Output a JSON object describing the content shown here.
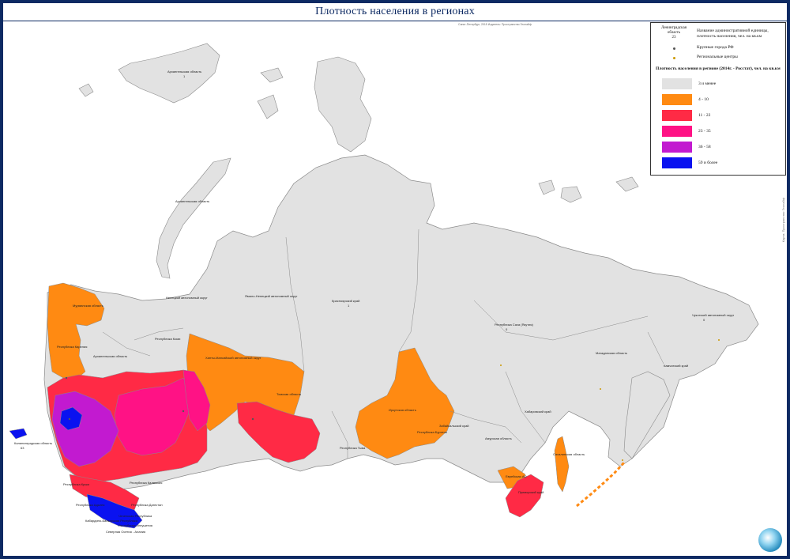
{
  "title": "Плотность населения в регионах",
  "credit": "Санкт-Петербург, 2015 Издатель: Пространство Геолайф",
  "side_credit": "Карта: Пространство Геолайф",
  "legend": {
    "sample_name": "Ленинградская область",
    "sample_value": "23",
    "sample_desc": "Название административной единицы, плотность населения, чел. на кв.км",
    "cities_label": "Крупные города РФ",
    "centers_label": "Региональные центры",
    "density_title": "Плотность населения в регионе (2014г. - Росстат), чел. на кв.км",
    "classes": [
      {
        "label": "3 и менее",
        "color": "#e2e2e2"
      },
      {
        "label": "4 - 10",
        "color": "#ff8a12"
      },
      {
        "label": "11 - 22",
        "color": "#ff2a45"
      },
      {
        "label": "23 - 35",
        "color": "#ff1285"
      },
      {
        "label": "36 - 58",
        "color": "#c21ad0"
      },
      {
        "label": "59 и более",
        "color": "#0a12f0"
      }
    ]
  },
  "colors": {
    "sea": "#ffffff",
    "land_low": "#e2e2e2",
    "border": "#8a8a8a",
    "frame": "#0d2a63"
  },
  "labels": {
    "arkhangelsk_islands": "Архангельская область",
    "arkhangelsk_islands_v": "1",
    "novaya_zemlya": "Архангельская область",
    "krasnoyarsk": "Красноярский край",
    "krasnoyarsk_v": "1",
    "yakutia": "Республика Саха (Якутия)",
    "yakutia_v": "0",
    "chukotka": "Чукотский автономный округ",
    "chukotka_v": "0",
    "magadan": "Магаданская область",
    "kamchatka": "Камчатский край",
    "khabarovsk": "Хабаровский край",
    "amur": "Амурская область",
    "zabaikal": "Забайкальский край",
    "buryatia": "Республика Бурятия",
    "irkutsk": "Иркутская область",
    "yamal": "Ямало-Ненецкий автономный округ",
    "nenets": "Ненецкий автономный округ",
    "komi": "Республика Коми",
    "khmao": "Ханты-Мансийский автономный округ",
    "tomsk": "Томская область",
    "tyva": "Республика Тыва",
    "kaliningrad": "Калининградская область",
    "kaliningrad_v": "63",
    "murmansk": "Мурманская область",
    "karelia": "Республика Карелия",
    "arkhangelsk": "Архангельская область",
    "north_caucasus": "Республика Дагестан",
    "chechnya": "Чеченская Республика",
    "ingushetia": "Республика Ингушетия",
    "kbr": "Кабардино-Балкарская Республика",
    "north_ossetia": "Северная Осетия - Алания",
    "adygea": "Республика Адыгея",
    "crimea": "Республика Крым",
    "kalmykia": "Республика Калмыкия",
    "sakhalin": "Сахалинская область",
    "primorye": "Приморский край",
    "jewish": "Еврейская АО"
  }
}
